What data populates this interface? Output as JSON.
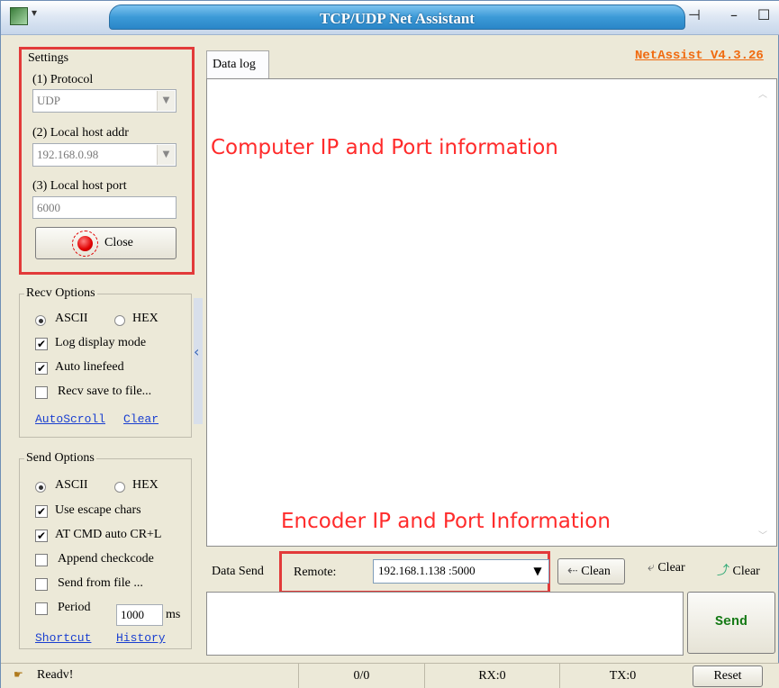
{
  "window": {
    "title": "TCP/UDP Net Assistant",
    "app_menu": "▾",
    "version_link": "NetAssist V4.3.26"
  },
  "settings": {
    "legend": "Settings",
    "protocol_label": "(1) Protocol",
    "protocol_value": "UDP",
    "local_addr_label": "(2) Local host addr",
    "local_addr_value": "192.168.0.98",
    "local_port_label": "(3) Local host port",
    "local_port_value": "6000",
    "close_label": "Close"
  },
  "recv_options": {
    "legend": "Recv Options",
    "ascii": "ASCII",
    "hex": "HEX",
    "log_display": "Log display mode",
    "auto_linefeed": "Auto linefeed",
    "save_to_file": "Recv save to file...",
    "autoscroll": "AutoScroll",
    "clear": "Clear"
  },
  "send_options": {
    "legend": "Send Options",
    "ascii": "ASCII",
    "hex": "HEX",
    "escape": "Use escape chars",
    "at_cmd": "AT CMD auto CR+L",
    "append": "Append checkcode",
    "from_file": "Send from file ...",
    "period": "Period",
    "period_value": "1000",
    "period_unit": "ms",
    "shortcut": "Shortcut",
    "history": "History"
  },
  "data_log": {
    "tab": "Data log",
    "annotation_top": "Computer IP and Port information",
    "annotation_bottom": "Encoder IP and Port Information"
  },
  "send_bar": {
    "label": "Data Send",
    "remote_label": "Remote:",
    "remote_value": "192.168.1.138 :5000",
    "clean": "Clean",
    "clear1": "Clear",
    "clear2": "Clear",
    "send": "Send"
  },
  "status": {
    "ready": "Readv!",
    "count": "0/0",
    "rx": "RX:0",
    "tx": "TX:0",
    "reset": "Reset"
  },
  "colors": {
    "annotation": "#ff2b2b",
    "version": "#f06a0f",
    "send": "#167a16",
    "link": "#1a3fd0"
  }
}
